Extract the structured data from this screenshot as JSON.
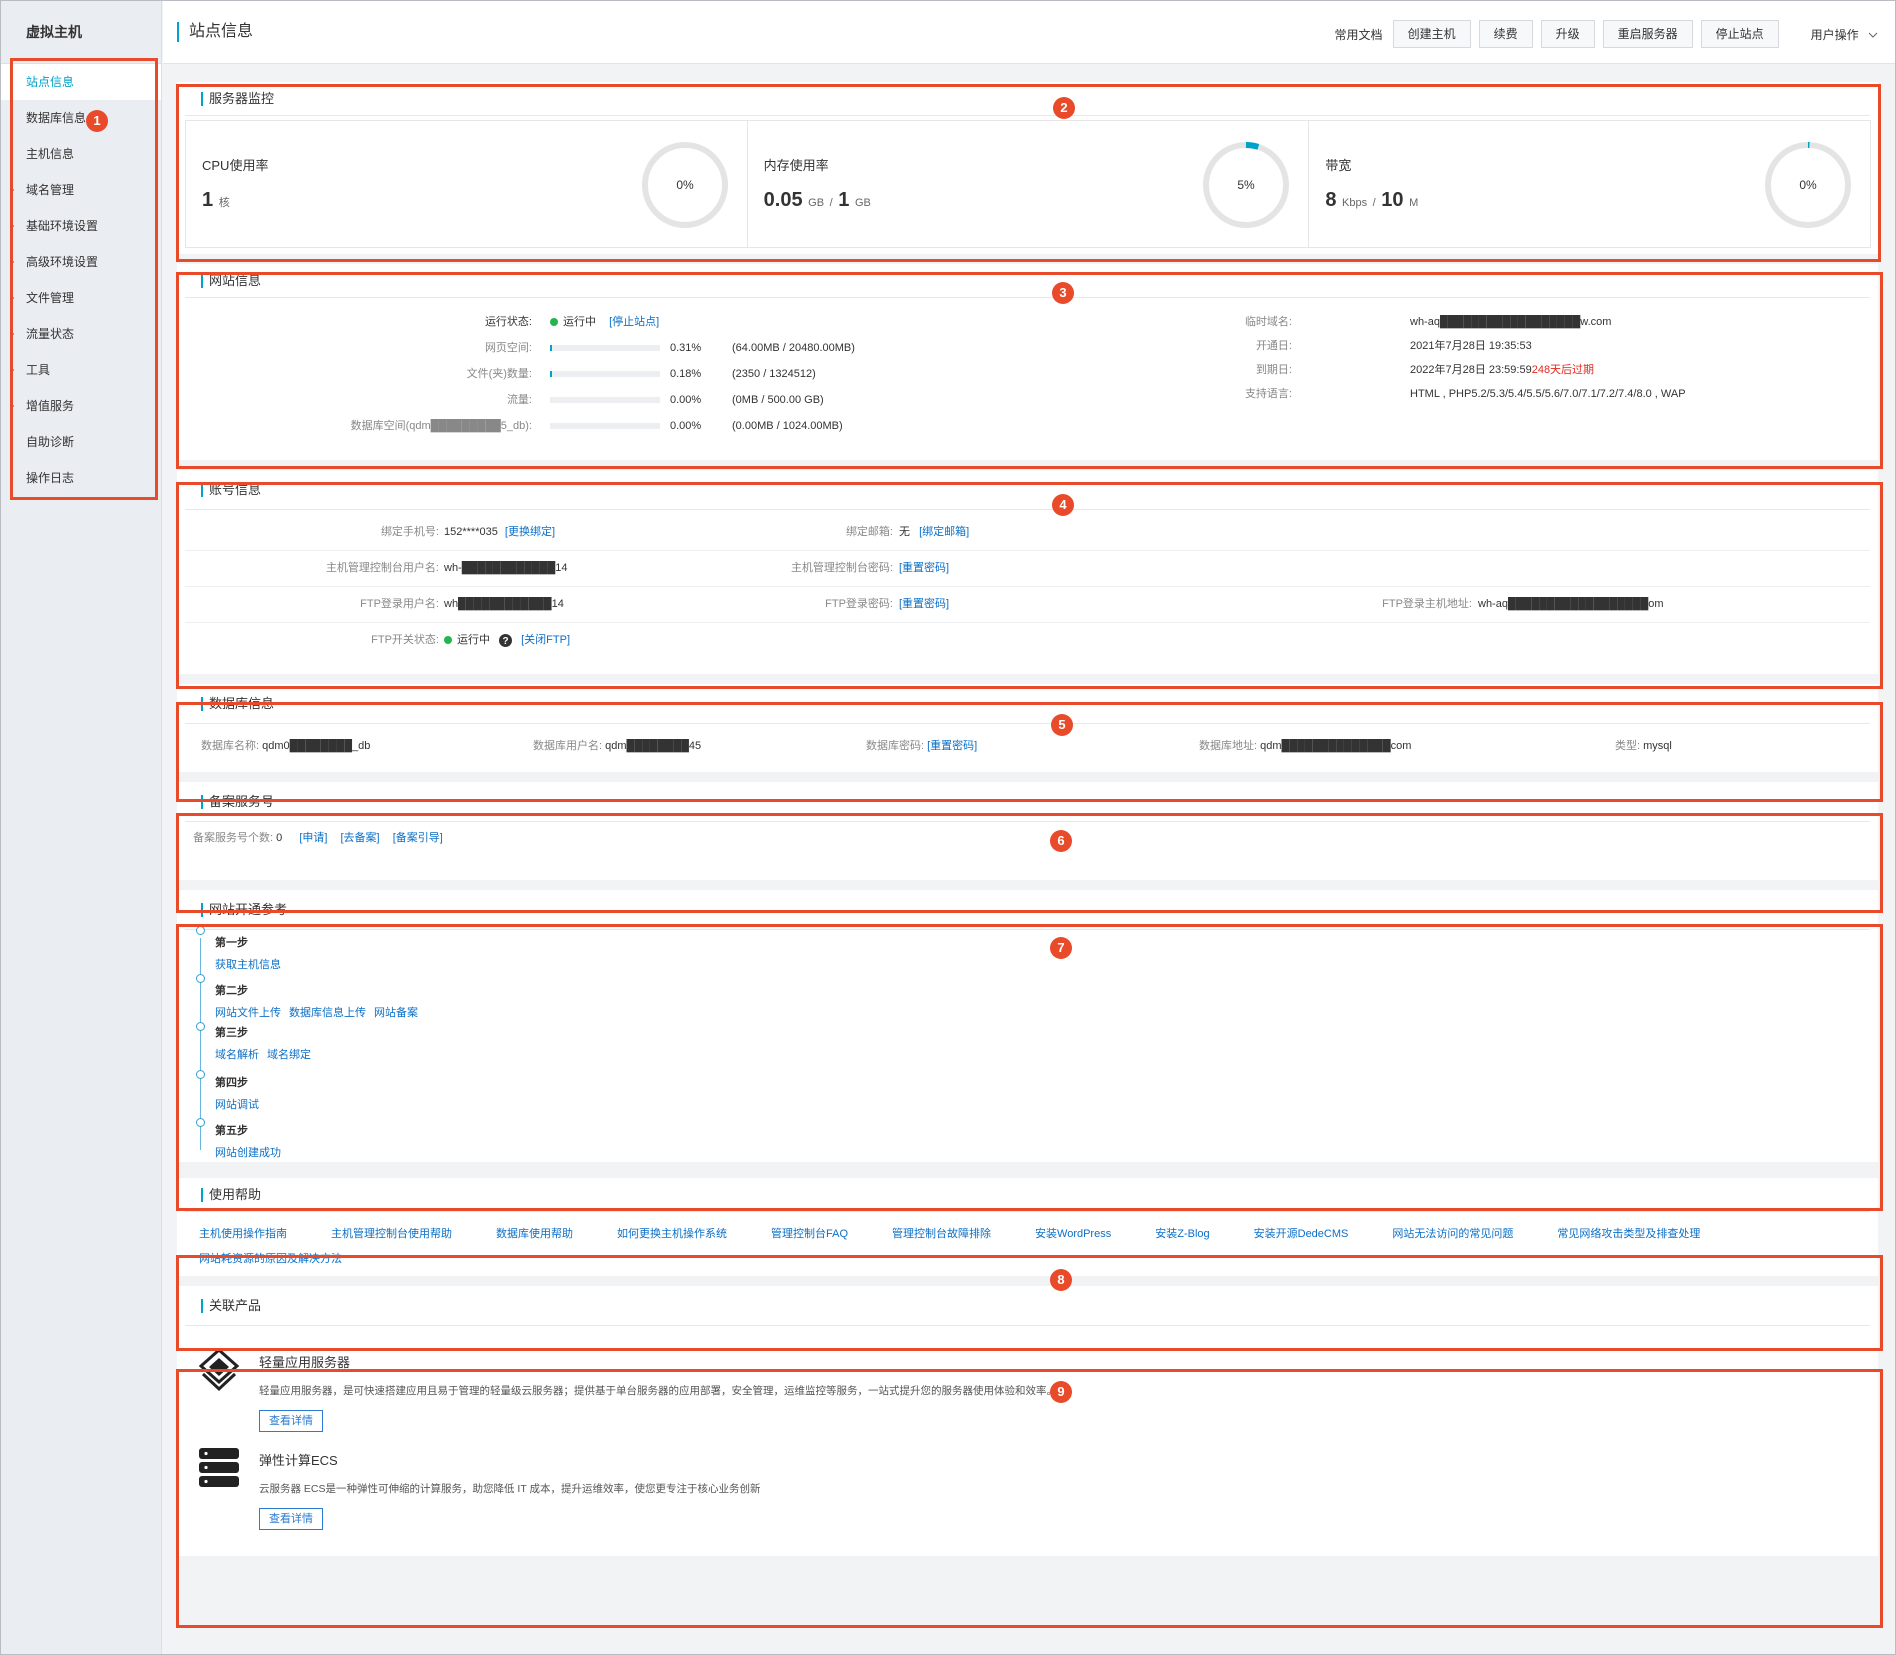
{
  "sidebar": {
    "title": "虚拟主机",
    "items": [
      {
        "label": "站点信息"
      },
      {
        "label": "数据库信息"
      },
      {
        "label": "主机信息"
      },
      {
        "label": "域名管理"
      },
      {
        "label": "基础环境设置"
      },
      {
        "label": "高级环境设置"
      },
      {
        "label": "文件管理"
      },
      {
        "label": "流量状态"
      },
      {
        "label": "工具"
      },
      {
        "label": "增值服务"
      },
      {
        "label": "自助诊断"
      },
      {
        "label": "操作日志"
      }
    ]
  },
  "topbar": {
    "title": "站点信息",
    "doc_link": "常用文档",
    "buttons": [
      "创建主机",
      "续费",
      "升级",
      "重启服务器",
      "停止站点"
    ],
    "user_menu": "用户操作",
    "user_menu_icon": "chevron-down-icon"
  },
  "monitor": {
    "title": "服务器监控",
    "cpu": {
      "label": "CPU使用率",
      "value": "1",
      "unit": "核",
      "percent_text": "0%",
      "percent": 0
    },
    "mem": {
      "label": "内存使用率",
      "used": "0.05",
      "used_unit": "GB",
      "sep": "/",
      "total": "1",
      "total_unit": "GB",
      "percent_text": "5%",
      "percent": 5
    },
    "bw": {
      "label": "带宽",
      "used": "8",
      "used_unit": "Kbps",
      "sep": "/",
      "total": "10",
      "total_unit": "M",
      "percent_text": "0%",
      "percent": 0.6
    },
    "ring_color": "#00a2ca"
  },
  "site": {
    "title": "网站信息",
    "status_label": "运行状态:",
    "status_value": "运行中",
    "status_link": "[停止站点]",
    "web_space_label": "网页空间:",
    "web_space_pct": "0.31%",
    "web_space_detail": "(64.00MB / 20480.00MB)",
    "web_space_fill": 0.31,
    "files_label": "文件(夹)数量:",
    "files_pct": "0.18%",
    "files_detail": "(2350 / 1324512)",
    "files_fill": 0.18,
    "traffic_label": "流量:",
    "traffic_pct": "0.00%",
    "traffic_detail": "(0MB / 500.00 GB)",
    "traffic_fill": 0,
    "db_space_label": "数据库空间(qdm█████████5_db):",
    "db_space_pct": "0.00%",
    "db_space_detail": "(0.00MB / 1024.00MB)",
    "db_space_fill": 0,
    "temp_domain_label": "临时域名:",
    "temp_domain_value": "wh-aq██████████████████w.com",
    "open_date_label": "开通日:",
    "open_date_value": "2021年7月28日 19:35:53",
    "expire_label": "到期日:",
    "expire_value": "2022年7月28日 23:59:59",
    "expire_warn": "248天后过期",
    "lang_label": "支持语言:",
    "lang_value": "HTML , PHP5.2/5.3/5.4/5.5/5.6/7.0/7.1/7.2/7.4/8.0 , WAP"
  },
  "account": {
    "title": "账号信息",
    "phone_label": "绑定手机号:",
    "phone_value": "152****035",
    "phone_link": "[更换绑定]",
    "email_label": "绑定邮箱:",
    "email_value": "无",
    "email_link": "[绑定邮箱]",
    "ctrl_user_label": "主机管理控制台用户名:",
    "ctrl_user_value": "wh-████████████14",
    "ctrl_pwd_label": "主机管理控制台密码:",
    "ctrl_pwd_link": "[重置密码]",
    "ftp_user_label": "FTP登录用户名:",
    "ftp_user_value": "wh████████████14",
    "ftp_pwd_label": "FTP登录密码:",
    "ftp_pwd_link": "[重置密码]",
    "ftp_host_label": "FTP登录主机地址:",
    "ftp_host_value": "wh-aq██████████████████om",
    "ftp_switch_label": "FTP开关状态:",
    "ftp_switch_value": "运行中",
    "ftp_help_icon": "question-circle-icon",
    "ftp_switch_link": "[关闭FTP]"
  },
  "database": {
    "title": "数据库信息",
    "name_label": "数据库名称:",
    "name_value": "qdm0████████_db",
    "user_label": "数据库用户名:",
    "user_value": "qdm████████45",
    "pwd_label": "数据库密码:",
    "pwd_link": "[重置密码]",
    "addr_label": "数据库地址:",
    "addr_value": "qdm██████████████com",
    "type_label": "类型:",
    "type_value": "mysql"
  },
  "record": {
    "title": "备案服务号",
    "count_label": "备案服务号个数:",
    "count_value": "0",
    "links": [
      "[申请]",
      "[去备案]",
      "[备案引导]"
    ]
  },
  "guide": {
    "title": "网站开通参考",
    "steps": [
      {
        "name": "第一步",
        "links": [
          "获取主机信息"
        ]
      },
      {
        "name": "第二步",
        "links": [
          "网站文件上传",
          "数据库信息上传",
          "网站备案"
        ]
      },
      {
        "name": "第三步",
        "links": [
          "域名解析",
          "域名绑定"
        ]
      },
      {
        "name": "第四步",
        "links": [
          "网站调试"
        ]
      },
      {
        "name": "第五步",
        "links": [
          "网站创建成功"
        ]
      }
    ]
  },
  "help": {
    "title": "使用帮助",
    "links": [
      "主机使用操作指南",
      "主机管理控制台使用帮助",
      "数据库使用帮助",
      "如何更换主机操作系统",
      "管理控制台FAQ",
      "管理控制台故障排除",
      "安装WordPress",
      "安装Z-Blog",
      "安装开源DedeCMS",
      "网站无法访问的常见问题",
      "常见网络攻击类型及排查处理",
      "网站耗资源的原因及解决方法"
    ]
  },
  "products": {
    "title": "关联产品",
    "items": [
      {
        "name": "轻量应用服务器",
        "desc": "轻量应用服务器，是可快速搭建应用且易于管理的轻量级云服务器；提供基于单台服务器的应用部署，安全管理，运维监控等服务，一站式提升您的服务器使用体验和效率。",
        "button": "查看详情",
        "icon": "lightweight-server-icon"
      },
      {
        "name": "弹性计算ECS",
        "desc": "云服务器 ECS是一种弹性可伸缩的计算服务，助您降低 IT 成本，提升运维效率，使您更专注于核心业务创新",
        "button": "查看详情",
        "icon": "server-stack-icon"
      }
    ]
  },
  "annotations": [
    "1",
    "2",
    "3",
    "4",
    "5",
    "6",
    "7",
    "8",
    "9"
  ]
}
